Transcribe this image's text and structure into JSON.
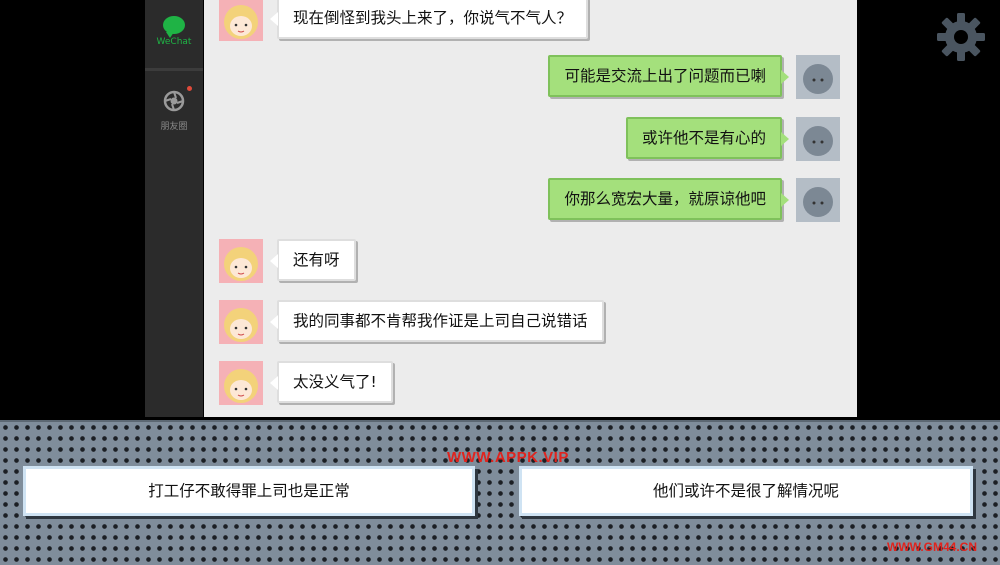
{
  "sidebar": {
    "items": [
      {
        "label": "WeChat",
        "icon": "chat-bubble-icon",
        "active": true,
        "color": "#1fb345"
      },
      {
        "label": "朋友圈",
        "icon": "moments-aperture-icon",
        "active": false,
        "color": "#8a8a8a",
        "has_notification": true
      }
    ]
  },
  "messages": [
    {
      "side": "left",
      "avatar": "girl-avatar",
      "text": "现在倒怪到我头上来了，你说气不气人？"
    },
    {
      "side": "right",
      "avatar": "user-avatar",
      "text": "可能是交流上出了问题而已喇"
    },
    {
      "side": "right",
      "avatar": "user-avatar",
      "text": "或许他不是有心的"
    },
    {
      "side": "right",
      "avatar": "user-avatar",
      "text": "你那么宽宏大量，就原谅他吧"
    },
    {
      "side": "left",
      "avatar": "girl-avatar",
      "text": "还有呀"
    },
    {
      "side": "left",
      "avatar": "girl-avatar",
      "text": "我的同事都不肯帮我作证是上司自己说错话"
    },
    {
      "side": "left",
      "avatar": "girl-avatar",
      "text": "太没义气了!"
    }
  ],
  "settings": {
    "icon": "gear-icon"
  },
  "choices": [
    {
      "label": "打工仔不敢得罪上司也是正常"
    },
    {
      "label": "他们或许不是很了解情况呢"
    }
  ],
  "watermarks": {
    "top": "WWW.APPK.VIP",
    "bottom": "WWW.GM44.CN"
  },
  "colors": {
    "sent_bubble": "#a4e07c",
    "received_bubble": "#ffffff",
    "sidebar_bg": "#2b2b2b",
    "chat_bg": "#ececec",
    "panel_bg": "#7f8d9b",
    "watermark": "#e0241e"
  }
}
